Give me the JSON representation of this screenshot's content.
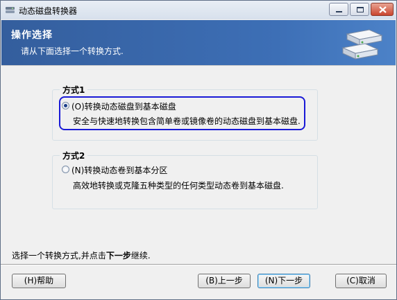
{
  "window": {
    "title": "动态磁盘转换器"
  },
  "header": {
    "title": "操作选择",
    "subtitle": "请从下面选择一个转换方式."
  },
  "options": [
    {
      "group_label": "方式1",
      "label": "(O)转换动态磁盘到基本磁盘",
      "description": "安全与快速地转换包含简单卷或镜像卷的动态磁盘到基本磁盘.",
      "selected": true
    },
    {
      "group_label": "方式2",
      "label": "(N)转换动态卷到基本分区",
      "description": "高效地转换或克隆五种类型的任何类型动态卷到基本磁盘.",
      "selected": false
    }
  ],
  "instruction": {
    "prefix": "选择一个转换方式,并点击",
    "bold": "下一步",
    "suffix": "继续."
  },
  "buttons": {
    "help": "(H)帮助",
    "back": "(B)上一步",
    "next": "(N)下一步",
    "cancel": "(C)取消"
  },
  "colors": {
    "header_bg": "#3d6fb6",
    "focus_ring": "#1919d6",
    "close_button": "#c9452e"
  },
  "icons": [
    "app-icon",
    "minimize-icon",
    "maximize-icon",
    "close-icon",
    "disk-convert-graphic"
  ]
}
